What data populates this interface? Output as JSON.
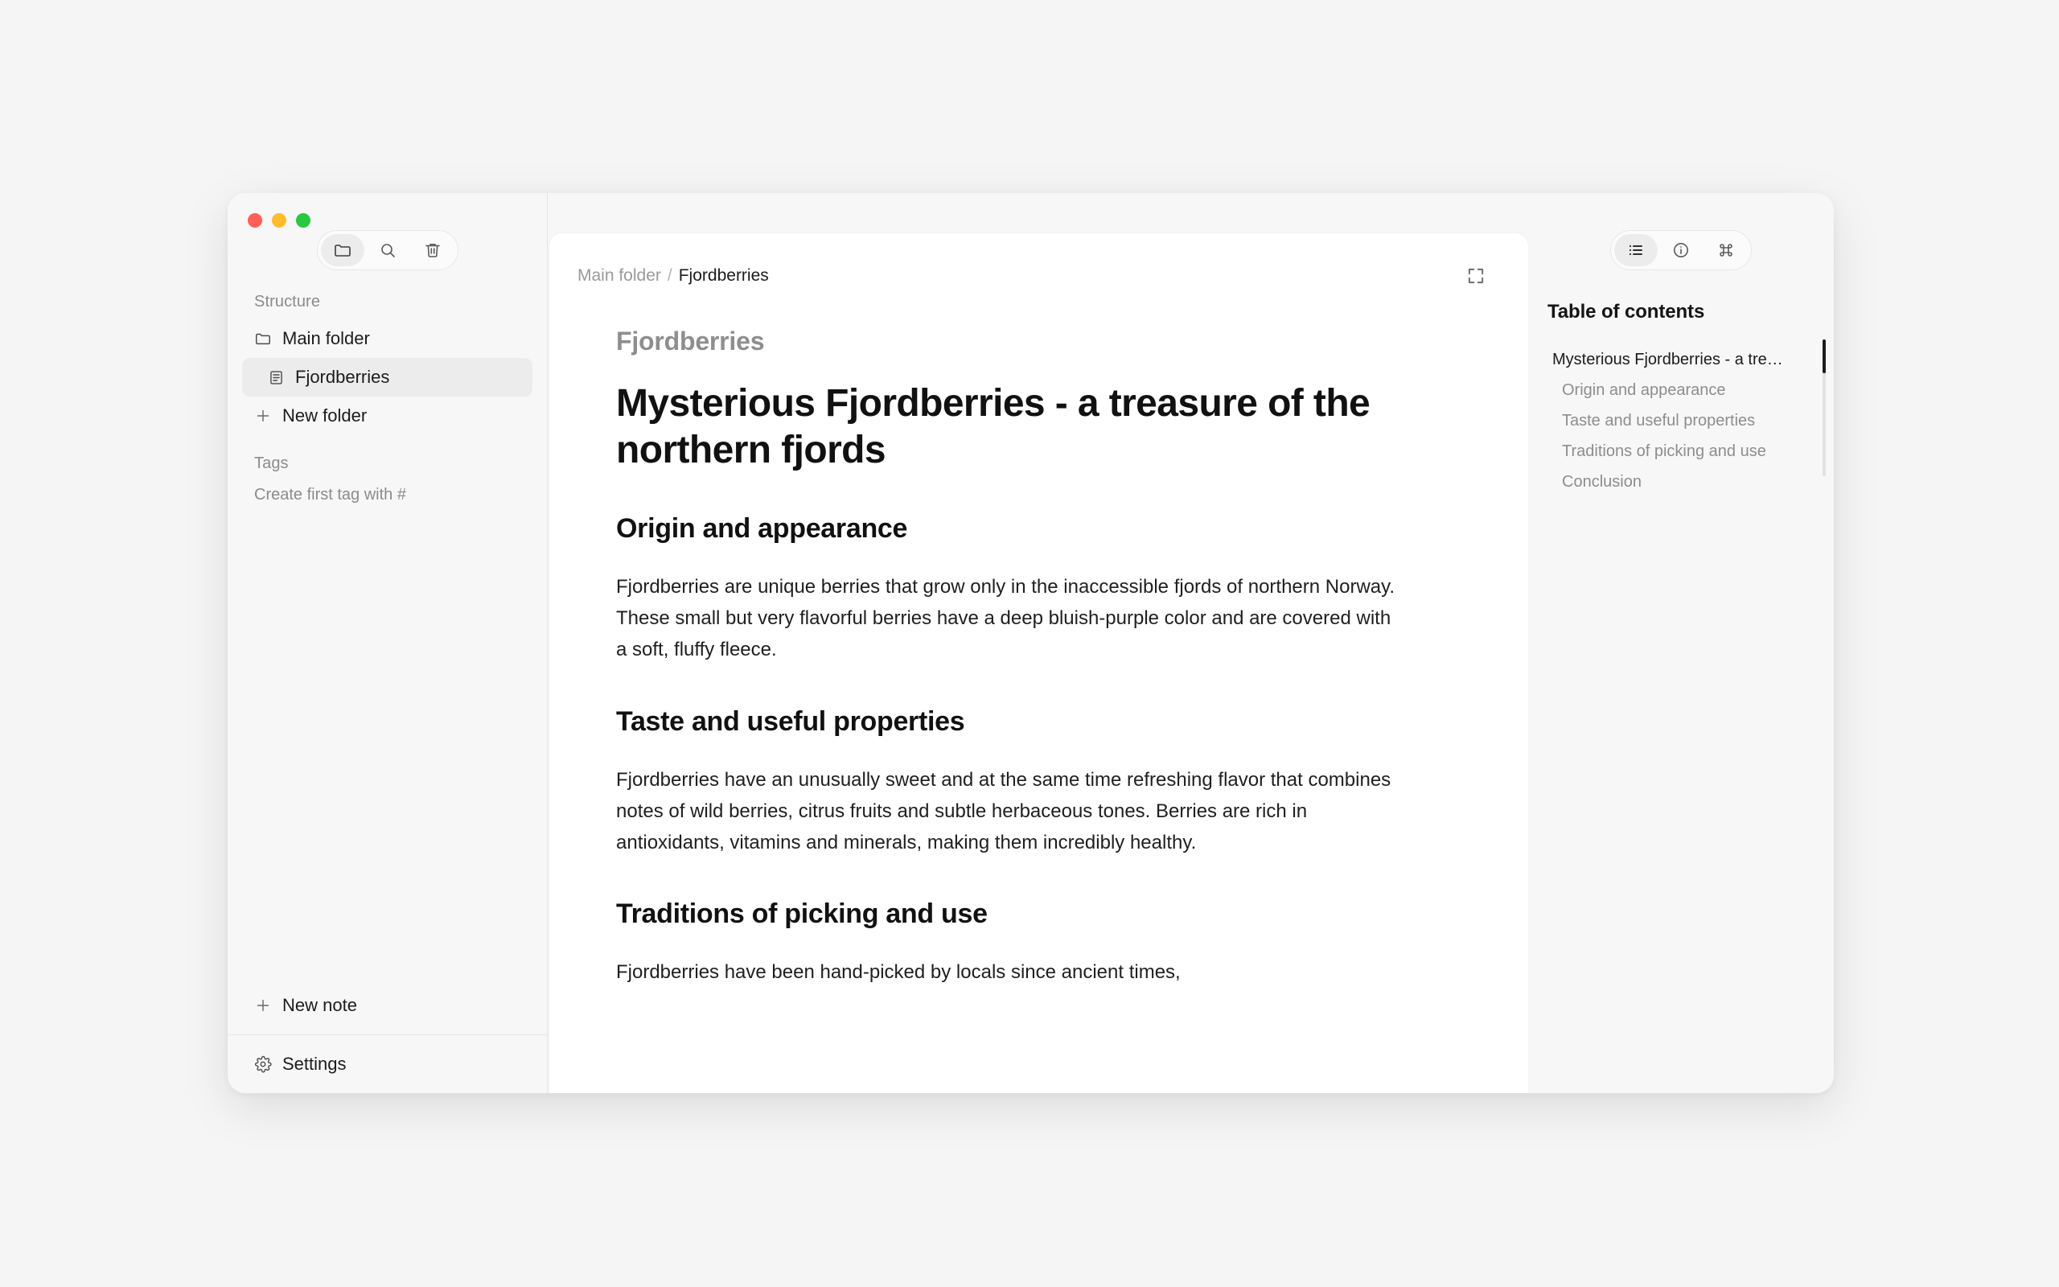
{
  "window": {
    "traffic_lights": {
      "close_color": "#ff5f57",
      "minimize_color": "#febc2e",
      "zoom_color": "#28c840"
    }
  },
  "sidebar": {
    "toolbar": [
      {
        "name": "folder-icon",
        "active": true
      },
      {
        "name": "search-icon",
        "active": false
      },
      {
        "name": "trash-icon",
        "active": false
      }
    ],
    "structure_label": "Structure",
    "items": [
      {
        "label": "Main folder",
        "icon": "folder-icon",
        "selected": false,
        "indent": false
      },
      {
        "label": "Fjordberries",
        "icon": "document-icon",
        "selected": true,
        "indent": true
      },
      {
        "label": "New folder",
        "icon": "plus-icon",
        "selected": false,
        "indent": false
      }
    ],
    "tags_label": "Tags",
    "tags_hint": "Create first tag with #",
    "new_note_label": "New note",
    "settings_label": "Settings"
  },
  "document": {
    "breadcrumb": {
      "parent": "Main folder",
      "separator": "/",
      "current": "Fjordberries"
    },
    "kicker": "Fjordberries",
    "title": "Mysterious Fjordberries - a treasure of the northern fjords",
    "sections": [
      {
        "heading": "Origin and appearance",
        "paragraph": "Fjordberries are unique berries that grow only in the inaccessible fjords of northern Norway. These small but very flavorful berries have a deep bluish-purple color and are covered with a soft, fluffy fleece."
      },
      {
        "heading": "Taste and useful properties",
        "paragraph": "Fjordberries have an unusually sweet and at the same time refreshing flavor that combines notes of wild berries, citrus fruits and subtle herbaceous tones. Berries are rich in antioxidants, vitamins and minerals, making them incredibly healthy."
      },
      {
        "heading": "Traditions of picking and use",
        "paragraph": "Fjordberries have been hand-picked by locals since ancient times,"
      }
    ]
  },
  "toc": {
    "toolbar": [
      {
        "name": "list-icon",
        "active": true
      },
      {
        "name": "info-icon",
        "active": false
      },
      {
        "name": "command-icon",
        "active": false
      }
    ],
    "title": "Table of contents",
    "items": [
      {
        "label": "Mysterious Fjordberries - a tre…",
        "level": 1,
        "active": true
      },
      {
        "label": "Origin and appearance",
        "level": 2,
        "active": false
      },
      {
        "label": "Taste and useful properties",
        "level": 2,
        "active": false
      },
      {
        "label": "Traditions of picking and use",
        "level": 2,
        "active": false
      },
      {
        "label": "Conclusion",
        "level": 2,
        "active": false
      }
    ]
  }
}
